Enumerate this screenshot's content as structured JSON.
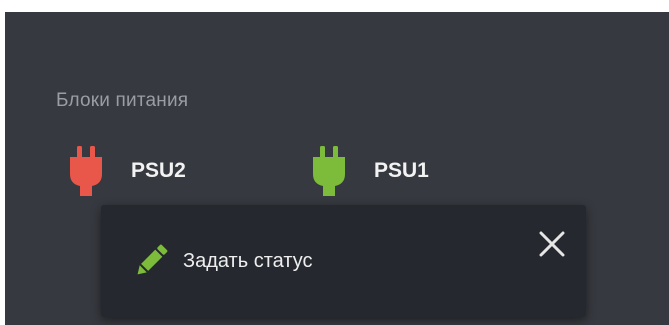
{
  "section": {
    "title": "Блоки питания"
  },
  "psus": [
    {
      "label": "PSU2",
      "icon": "power-plug-icon",
      "status_color": "#e8574a"
    },
    {
      "label": "PSU1",
      "icon": "power-plug-icon",
      "status_color": "#7dbb3a"
    }
  ],
  "popover": {
    "action_label": "Задать статус",
    "action_icon": "pencil-icon",
    "action_icon_color": "#7dbb3a",
    "close_icon": "close-icon"
  }
}
